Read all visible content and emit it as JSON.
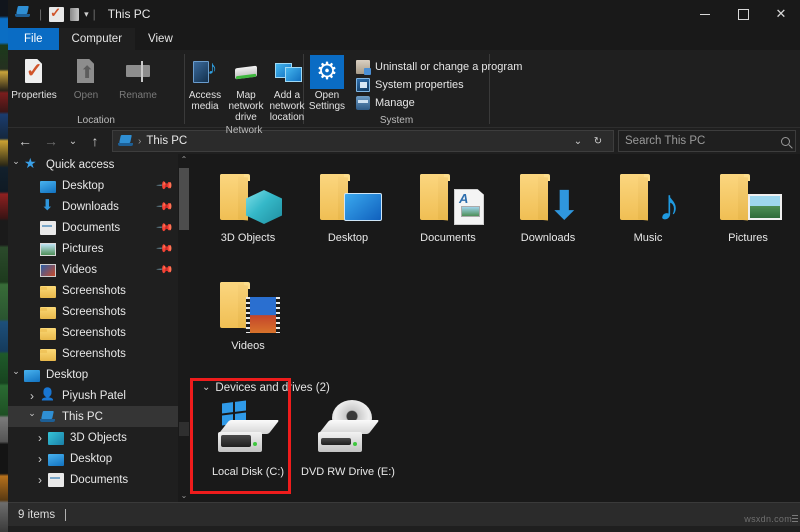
{
  "window": {
    "title": "This PC",
    "icon": "this-pc-icon",
    "quick_access_toolbar": [
      {
        "name": "properties-qat-icon",
        "label": "Properties"
      },
      {
        "name": "drive-qat-icon",
        "label": "Drive"
      },
      {
        "name": "customize-caret-icon",
        "label": "Customize Quick Access Toolbar"
      }
    ],
    "controls": {
      "minimize": "minimize-icon",
      "maximize": "maximize-icon",
      "close": "close-icon"
    }
  },
  "tabs": [
    {
      "label": "File",
      "state": "accent"
    },
    {
      "label": "Computer",
      "state": "active"
    },
    {
      "label": "View",
      "state": "normal"
    }
  ],
  "ribbon": {
    "groups": [
      {
        "label": "Location",
        "buttons": [
          {
            "label": "Properties",
            "icon": "properties-icon",
            "enabled": true
          },
          {
            "label": "Open",
            "icon": "open-icon",
            "enabled": false
          },
          {
            "label": "Rename",
            "icon": "rename-icon",
            "enabled": false
          }
        ]
      },
      {
        "label": "Network",
        "buttons": [
          {
            "label": "Access media",
            "icon": "access-media-icon",
            "enabled": true,
            "dropdown": true
          },
          {
            "label": "Map network drive",
            "icon": "map-network-drive-icon",
            "enabled": true,
            "dropdown": true
          },
          {
            "label": "Add a network location",
            "icon": "add-network-location-icon",
            "enabled": true,
            "dropdown": false
          }
        ]
      },
      {
        "label": "System",
        "big_button": {
          "label_line1": "Open",
          "label_line2": "Settings",
          "icon": "settings-gear-icon"
        },
        "small_buttons": [
          {
            "label": "Uninstall or change a program",
            "icon": "uninstall-program-icon"
          },
          {
            "label": "System properties",
            "icon": "system-properties-icon"
          },
          {
            "label": "Manage",
            "icon": "manage-icon"
          }
        ]
      }
    ]
  },
  "addressbar": {
    "back": "back-arrow-icon",
    "forward": "forward-arrow-icon",
    "recent": "recent-locations-icon",
    "up": "up-arrow-icon",
    "crumb_icon": "this-pc-icon",
    "crumb_text": "This PC",
    "dropdown": "address-dropdown-icon",
    "refresh": "refresh-icon",
    "search_placeholder": "Search This PC",
    "search_icon": "search-icon"
  },
  "navpane": {
    "items": [
      {
        "label": "Quick access",
        "icon": "star-icon",
        "chevron": "down",
        "indent": 0,
        "pinned": false,
        "selected": false
      },
      {
        "label": "Desktop",
        "icon": "desktop-icon",
        "chevron": "none",
        "indent": 1,
        "pinned": true,
        "selected": false
      },
      {
        "label": "Downloads",
        "icon": "downloads-icon",
        "chevron": "none",
        "indent": 1,
        "pinned": true,
        "selected": false
      },
      {
        "label": "Documents",
        "icon": "documents-icon",
        "chevron": "none",
        "indent": 1,
        "pinned": true,
        "selected": false
      },
      {
        "label": "Pictures",
        "icon": "pictures-icon",
        "chevron": "none",
        "indent": 1,
        "pinned": true,
        "selected": false
      },
      {
        "label": "Videos",
        "icon": "videos-icon",
        "chevron": "none",
        "indent": 1,
        "pinned": true,
        "selected": false
      },
      {
        "label": "Screenshots",
        "icon": "folder-icon",
        "chevron": "none",
        "indent": 1,
        "pinned": false,
        "selected": false
      },
      {
        "label": "Screenshots",
        "icon": "folder-icon",
        "chevron": "none",
        "indent": 1,
        "pinned": false,
        "selected": false
      },
      {
        "label": "Screenshots",
        "icon": "folder-icon",
        "chevron": "none",
        "indent": 1,
        "pinned": false,
        "selected": false
      },
      {
        "label": "Screenshots",
        "icon": "folder-icon",
        "chevron": "none",
        "indent": 1,
        "pinned": false,
        "selected": false
      },
      {
        "label": "Desktop",
        "icon": "desktop-icon",
        "chevron": "down",
        "indent": 0,
        "pinned": false,
        "selected": false
      },
      {
        "label": "Piyush Patel",
        "icon": "user-icon",
        "chevron": "right",
        "indent": 1,
        "pinned": false,
        "selected": false
      },
      {
        "label": "This PC",
        "icon": "this-pc-icon",
        "chevron": "down",
        "indent": 1,
        "pinned": false,
        "selected": true
      },
      {
        "label": "3D Objects",
        "icon": "3d-objects-icon",
        "chevron": "right",
        "indent": 2,
        "pinned": false,
        "selected": false
      },
      {
        "label": "Desktop",
        "icon": "desktop-icon",
        "chevron": "right",
        "indent": 2,
        "pinned": false,
        "selected": false
      },
      {
        "label": "Documents",
        "icon": "documents-icon",
        "chevron": "right",
        "indent": 2,
        "pinned": false,
        "selected": false
      }
    ],
    "scrollbar": {
      "up": "scroll-up-icon",
      "down": "scroll-down-icon"
    }
  },
  "content": {
    "folders": [
      {
        "label": "3D Objects",
        "icon": "folder-3d-objects-icon"
      },
      {
        "label": "Desktop",
        "icon": "folder-desktop-icon"
      },
      {
        "label": "Documents",
        "icon": "folder-documents-icon"
      },
      {
        "label": "Downloads",
        "icon": "folder-downloads-icon"
      },
      {
        "label": "Music",
        "icon": "folder-music-icon"
      },
      {
        "label": "Pictures",
        "icon": "folder-pictures-icon"
      },
      {
        "label": "Videos",
        "icon": "folder-videos-icon"
      }
    ],
    "drives_group_label": "Devices and drives (2)",
    "drives_group_chevron": "collapse-chevron-icon",
    "drives": [
      {
        "label": "Local Disk (C:)",
        "icon": "local-disk-icon",
        "highlighted": true
      },
      {
        "label": "DVD RW Drive (E:)",
        "icon": "dvd-rw-drive-icon",
        "highlighted": false
      }
    ],
    "highlight_color": "#ee1c1c"
  },
  "statusbar": {
    "item_count": "9 items",
    "watermark": "wsxdn.com"
  }
}
